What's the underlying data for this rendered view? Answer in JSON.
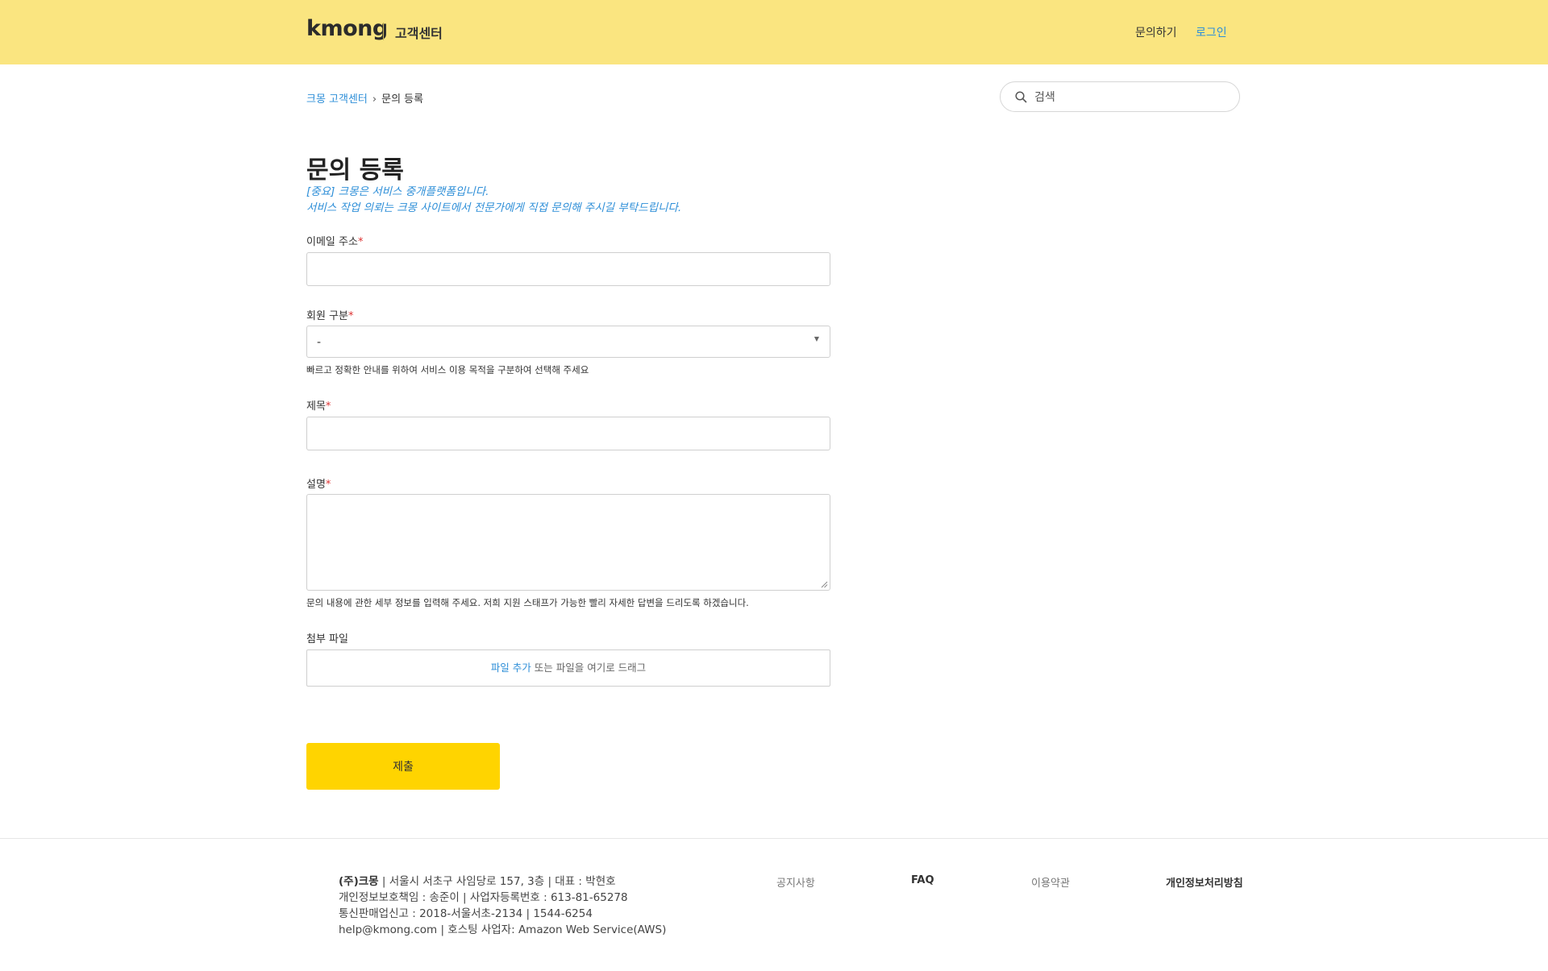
{
  "header": {
    "logo": "kmong",
    "subtitle": "고객센터",
    "nav_inquiry": "문의하기",
    "nav_login": "로그인"
  },
  "breadcrumb": {
    "home": "크몽 고객센터",
    "separator": "›",
    "current": "문의 등록"
  },
  "search": {
    "placeholder": "검색"
  },
  "page": {
    "title": "문의 등록",
    "notice_line1": "[중요] 크몽은 서비스 중개플랫폼입니다.",
    "notice_line2": "서비스 작업 의뢰는 크몽 사이트에서 전문가에게 직접 문의해 주시길 부탁드립니다."
  },
  "form": {
    "email_label": "이메일 주소",
    "member_type_label": "회원 구분",
    "member_type_value": "-",
    "member_type_hint": "빠르고 정확한 안내를 위하여 서비스 이용 목적을 구분하여 선택해 주세요",
    "subject_label": "제목",
    "description_label": "설명",
    "description_hint": "문의 내용에 관한 세부 정보를 입력해 주세요. 저희 지원 스태프가 가능한 빨리 자세한 답변을 드리도록 하겠습니다.",
    "attachment_label": "첨부 파일",
    "attachment_link": "파일 추가",
    "attachment_text": " 또는 파일을 여기로 드래그",
    "required_mark": "*",
    "submit_label": "제출"
  },
  "footer": {
    "company": "(주)크몽",
    "line1_rest": " | 서울시 서초구 사임당로 157, 3층 | 대표 : 박현호",
    "line2": "개인정보보호책임 : 송준이 | 사업자등록번호 : 613-81-65278",
    "line3": "통신판매업신고 : 2018-서울서초-2134 | 1544-6254",
    "line4": "help@kmong.com | 호스팅 사업자: Amazon Web Service(AWS)",
    "links": [
      "공지사항",
      "FAQ",
      "이용약관",
      "개인정보처리방침"
    ]
  },
  "colors": {
    "header_bg": "#fae580",
    "accent_blue": "#2f8fd8",
    "submit_bg": "#ffd400",
    "required": "#dd3333"
  },
  "icons": {
    "search": "search-icon",
    "select_arrow": "caret-down-icon",
    "breadcrumb_sep": "chevron-right-icon"
  }
}
